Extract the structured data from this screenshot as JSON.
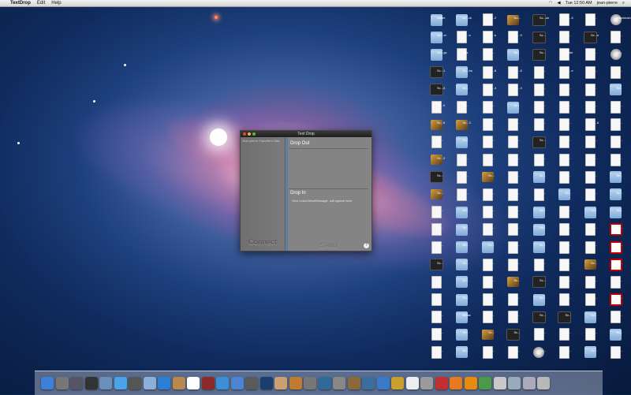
{
  "menubar": {
    "apple": "",
    "app_name": "TextDrop",
    "menus": [
      "Edit",
      "Help"
    ],
    "clock": "Tue 12:50 AM",
    "user": "jean-pierre"
  },
  "window": {
    "title": "Text Drop",
    "sidebar_header": "Jean-pierre Fauvelle's Mac",
    "drop_out_label": "Drop Out",
    "drop_in_label": "Drop In",
    "drop_in_hint": "Your Links/Infos/Message, will appear here.",
    "connect_label": "Connect",
    "send_label": "Send",
    "help_label": "?"
  },
  "desktop_icons": [
    {
      "type": "folder",
      "label": "wallet"
    },
    {
      "type": "folder",
      "label": "co...ck"
    },
    {
      "type": "doc",
      "label": "Sc...2"
    },
    {
      "type": "img",
      "label": "No..."
    },
    {
      "type": "dark",
      "label": "Sc...ok"
    },
    {
      "type": "doc",
      "label": "Sc...6"
    },
    {
      "type": "doc",
      "label": "Sc..."
    },
    {
      "type": "disk",
      "label": "Macintosh"
    },
    {
      "type": "folder",
      "label": "Ne...er"
    },
    {
      "type": "doc",
      "label": "Sc...b"
    },
    {
      "type": "doc",
      "label": "Sc...b"
    },
    {
      "type": "doc",
      "label": "Sc...9"
    },
    {
      "type": "dark",
      "label": "Sc..."
    },
    {
      "type": "doc",
      "label": "Sc..."
    },
    {
      "type": "dark",
      "label": "Sc...e"
    },
    {
      "type": "doc",
      "label": "Sc..."
    },
    {
      "type": "folder",
      "label": "Su...gs"
    },
    {
      "type": "doc",
      "label": "Sbs"
    },
    {
      "type": "doc",
      "label": "Sc..."
    },
    {
      "type": "folder",
      "label": "Sc..."
    },
    {
      "type": "dark",
      "label": "Sc..."
    },
    {
      "type": "doc",
      "label": "guide"
    },
    {
      "type": "doc",
      "label": "Sc..."
    },
    {
      "type": "disk",
      "label": "Sc..."
    },
    {
      "type": "dark",
      "label": "Sc...1"
    },
    {
      "type": "folder",
      "label": "Sc...bs"
    },
    {
      "type": "doc",
      "label": "Sc...8"
    },
    {
      "type": "doc",
      "label": "Sc...8"
    },
    {
      "type": "doc",
      "label": "Sc..."
    },
    {
      "type": "doc",
      "label": "Sc...e"
    },
    {
      "type": "doc",
      "label": "Sc..."
    },
    {
      "type": "doc",
      "label": "Sc..."
    },
    {
      "type": "dark",
      "label": "Sc...4"
    },
    {
      "type": "folder",
      "label": "Sc..."
    },
    {
      "type": "doc",
      "label": "Sc...4"
    },
    {
      "type": "doc",
      "label": "Sc...4"
    },
    {
      "type": "doc",
      "label": "Sc..."
    },
    {
      "type": "doc",
      "label": "Sc..."
    },
    {
      "type": "doc",
      "label": "gc..."
    },
    {
      "type": "folder",
      "label": "Sc..."
    },
    {
      "type": "doc",
      "label": "Sc...0"
    },
    {
      "type": "doc",
      "label": "Sc..."
    },
    {
      "type": "doc",
      "label": "Sc..."
    },
    {
      "type": "folder",
      "label": "Sc..."
    },
    {
      "type": "doc",
      "label": "Ca..."
    },
    {
      "type": "doc",
      "label": "Sc..."
    },
    {
      "type": "doc",
      "label": "Sc..."
    },
    {
      "type": "doc",
      "label": "Sc..."
    },
    {
      "type": "img",
      "label": "Sc...6"
    },
    {
      "type": "img",
      "label": "Sc...3"
    },
    {
      "type": "doc",
      "label": "Sc..."
    },
    {
      "type": "doc",
      "label": "Sc..."
    },
    {
      "type": "doc",
      "label": "Sc..."
    },
    {
      "type": "doc",
      "label": "Sc..."
    },
    {
      "type": "doc",
      "label": "Sc...6"
    },
    {
      "type": "doc",
      "label": "Sc..."
    },
    {
      "type": "doc",
      "label": "Sc..."
    },
    {
      "type": "folder",
      "label": "Sc..."
    },
    {
      "type": "doc",
      "label": "Sc..."
    },
    {
      "type": "doc",
      "label": "Sc..."
    },
    {
      "type": "dark",
      "label": "Sc..."
    },
    {
      "type": "doc",
      "label": "Sc..."
    },
    {
      "type": "doc",
      "label": "Sc..."
    },
    {
      "type": "doc",
      "label": "Sc..."
    },
    {
      "type": "img",
      "label": "Sc...2"
    },
    {
      "type": "doc",
      "label": "Sc..."
    },
    {
      "type": "doc",
      "label": "Sc..."
    },
    {
      "type": "doc",
      "label": "Sc..."
    },
    {
      "type": "doc",
      "label": "Sc..."
    },
    {
      "type": "doc",
      "label": "Sc..."
    },
    {
      "type": "doc",
      "label": "Sc..."
    },
    {
      "type": "doc",
      "label": "Sc..."
    },
    {
      "type": "dark",
      "label": "Sc..."
    },
    {
      "type": "doc",
      "label": "Sc..."
    },
    {
      "type": "img",
      "label": "Sc..."
    },
    {
      "type": "doc",
      "label": "Sc..."
    },
    {
      "type": "folder",
      "label": "Sc..."
    },
    {
      "type": "doc",
      "label": "Sc..."
    },
    {
      "type": "doc",
      "label": "Sc..."
    },
    {
      "type": "folder",
      "label": "Sc..."
    },
    {
      "type": "img",
      "label": "Sc..."
    },
    {
      "type": "doc",
      "label": "Sc..."
    },
    {
      "type": "doc",
      "label": "Sc..."
    },
    {
      "type": "doc",
      "label": "Sc..."
    },
    {
      "type": "doc",
      "label": "Sc..."
    },
    {
      "type": "folder",
      "label": "Sc..."
    },
    {
      "type": "doc",
      "label": "Sc..."
    },
    {
      "type": "folder",
      "label": "Sc..."
    },
    {
      "type": "doc",
      "label": "Sc..."
    },
    {
      "type": "folder",
      "label": "Sc..."
    },
    {
      "type": "doc",
      "label": "Sc..."
    },
    {
      "type": "doc",
      "label": "Sc..."
    },
    {
      "type": "folder",
      "label": "Sc..."
    },
    {
      "type": "doc",
      "label": "Sc..."
    },
    {
      "type": "folder",
      "label": "Sc..."
    },
    {
      "type": "folder",
      "label": "Sc..."
    },
    {
      "type": "doc",
      "label": "Sc..."
    },
    {
      "type": "folder",
      "label": "Sc..."
    },
    {
      "type": "doc",
      "label": "Sc..."
    },
    {
      "type": "doc",
      "label": "Sc..."
    },
    {
      "type": "folder",
      "label": "Sc..."
    },
    {
      "type": "doc",
      "label": "Sc..."
    },
    {
      "type": "doc",
      "label": "Sc..."
    },
    {
      "type": "red",
      "label": "Sc..."
    },
    {
      "type": "doc",
      "label": "Sc..."
    },
    {
      "type": "folder",
      "label": "Sc..."
    },
    {
      "type": "folder",
      "label": "Sc..."
    },
    {
      "type": "doc",
      "label": "Sc..."
    },
    {
      "type": "folder",
      "label": "Sc..."
    },
    {
      "type": "doc",
      "label": "Sc..."
    },
    {
      "type": "doc",
      "label": "Sc..."
    },
    {
      "type": "red",
      "label": "Sc..."
    },
    {
      "type": "dark",
      "label": "Sc..."
    },
    {
      "type": "folder",
      "label": "Sc..."
    },
    {
      "type": "doc",
      "label": "Sc..."
    },
    {
      "type": "doc",
      "label": "Sc..."
    },
    {
      "type": "doc",
      "label": "Sc..."
    },
    {
      "type": "doc",
      "label": "Sc..."
    },
    {
      "type": "img",
      "label": "Sc..."
    },
    {
      "type": "red",
      "label": "Sc..."
    },
    {
      "type": "doc",
      "label": "h"
    },
    {
      "type": "folder",
      "label": "Sc..."
    },
    {
      "type": "doc",
      "label": "Sc..."
    },
    {
      "type": "img",
      "label": "Sc..."
    },
    {
      "type": "dark",
      "label": "Sc..."
    },
    {
      "type": "doc",
      "label": "Sc..."
    },
    {
      "type": "doc",
      "label": "Sc..."
    },
    {
      "type": "doc",
      "label": "Sc..."
    },
    {
      "type": "doc",
      "label": "m"
    },
    {
      "type": "folder",
      "label": "Sc..."
    },
    {
      "type": "doc",
      "label": "Sc..."
    },
    {
      "type": "doc",
      "label": "Sc..."
    },
    {
      "type": "folder",
      "label": "Sc..."
    },
    {
      "type": "doc",
      "label": "Sc..."
    },
    {
      "type": "doc",
      "label": "Sc..."
    },
    {
      "type": "red",
      "label": "Sc..."
    },
    {
      "type": "doc",
      "label": "Sc..."
    },
    {
      "type": "folder",
      "label": "filefac"
    },
    {
      "type": "doc",
      "label": "Sc..."
    },
    {
      "type": "doc",
      "label": "Sc..."
    },
    {
      "type": "dark",
      "label": "Sc..."
    },
    {
      "type": "dark",
      "label": "Sc..."
    },
    {
      "type": "folder",
      "label": "Sc..."
    },
    {
      "type": "doc",
      "label": "Sc..."
    },
    {
      "type": "doc",
      "label": "Sc..."
    },
    {
      "type": "folder",
      "label": "Sc..."
    },
    {
      "type": "img",
      "label": "Sc..."
    },
    {
      "type": "dark",
      "label": "Sc..."
    },
    {
      "type": "doc",
      "label": "Sc..."
    },
    {
      "type": "doc",
      "label": "Sc..."
    },
    {
      "type": "doc",
      "label": "Sc..."
    },
    {
      "type": "folder",
      "label": "Sc..."
    },
    {
      "type": "doc",
      "label": "Sc..."
    },
    {
      "type": "folder",
      "label": "Sc..."
    },
    {
      "type": "doc",
      "label": "Sc..."
    },
    {
      "type": "doc",
      "label": "Sc..."
    },
    {
      "type": "disk",
      "label": "Sc..."
    },
    {
      "type": "doc",
      "label": "Sc..."
    },
    {
      "type": "folder",
      "label": "Sc..."
    },
    {
      "type": "doc",
      "label": "Sc..."
    }
  ],
  "dock": [
    {
      "name": "finder-icon",
      "color": "#3d7fd9"
    },
    {
      "name": "launchpad-icon",
      "color": "#777777"
    },
    {
      "name": "mission-control-icon",
      "color": "#556"
    },
    {
      "name": "dashboard-icon",
      "color": "#333"
    },
    {
      "name": "preview-icon",
      "color": "#6a8fb8"
    },
    {
      "name": "ichat-icon",
      "color": "#4aa3e8"
    },
    {
      "name": "facetime-icon",
      "color": "#555"
    },
    {
      "name": "mail-icon",
      "color": "#8ab0d8"
    },
    {
      "name": "app-store-icon",
      "color": "#2b80d6"
    },
    {
      "name": "address-book-icon",
      "color": "#b88a50"
    },
    {
      "name": "calendar-icon",
      "color": "#ffffff"
    },
    {
      "name": "photo-booth-icon",
      "color": "#8a2a2a"
    },
    {
      "name": "safari-icon",
      "color": "#3a8fd6"
    },
    {
      "name": "itunes-icon",
      "color": "#4b84d2"
    },
    {
      "name": "imovie-icon",
      "color": "#5a5a5a"
    },
    {
      "name": "photoshop-icon",
      "color": "#1b3d6c"
    },
    {
      "name": "iphoto-icon",
      "color": "#caa070"
    },
    {
      "name": "garageband-icon",
      "color": "#c27a30"
    },
    {
      "name": "utilities-icon",
      "color": "#777777"
    },
    {
      "name": "time-machine-icon",
      "color": "#2e6a9a"
    },
    {
      "name": "system-preferences-icon",
      "color": "#888888"
    },
    {
      "name": "keynote-icon",
      "color": "#8a6a3a"
    },
    {
      "name": "xcode-icon",
      "color": "#3a6ea0"
    },
    {
      "name": "network-utility-icon",
      "color": "#3a7ac8"
    },
    {
      "name": "keychain-icon",
      "color": "#c8a030"
    },
    {
      "name": "textedit-icon",
      "color": "#eeeeee"
    },
    {
      "name": "automator-icon",
      "color": "#9a9a9a"
    },
    {
      "name": "transmission-icon",
      "color": "#c03030"
    },
    {
      "name": "firefox-icon",
      "color": "#e57a20"
    },
    {
      "name": "vlc-icon",
      "color": "#e88a10"
    },
    {
      "name": "activity-icon",
      "color": "#4a9a4a"
    },
    {
      "name": "textdrop-icon",
      "color": "#c8c8c8"
    },
    {
      "name": "downloads-stack-icon",
      "color": "#9ab"
    },
    {
      "name": "documents-stack-icon",
      "color": "#aab"
    },
    {
      "name": "trash-icon",
      "color": "#b8b8b8"
    }
  ]
}
